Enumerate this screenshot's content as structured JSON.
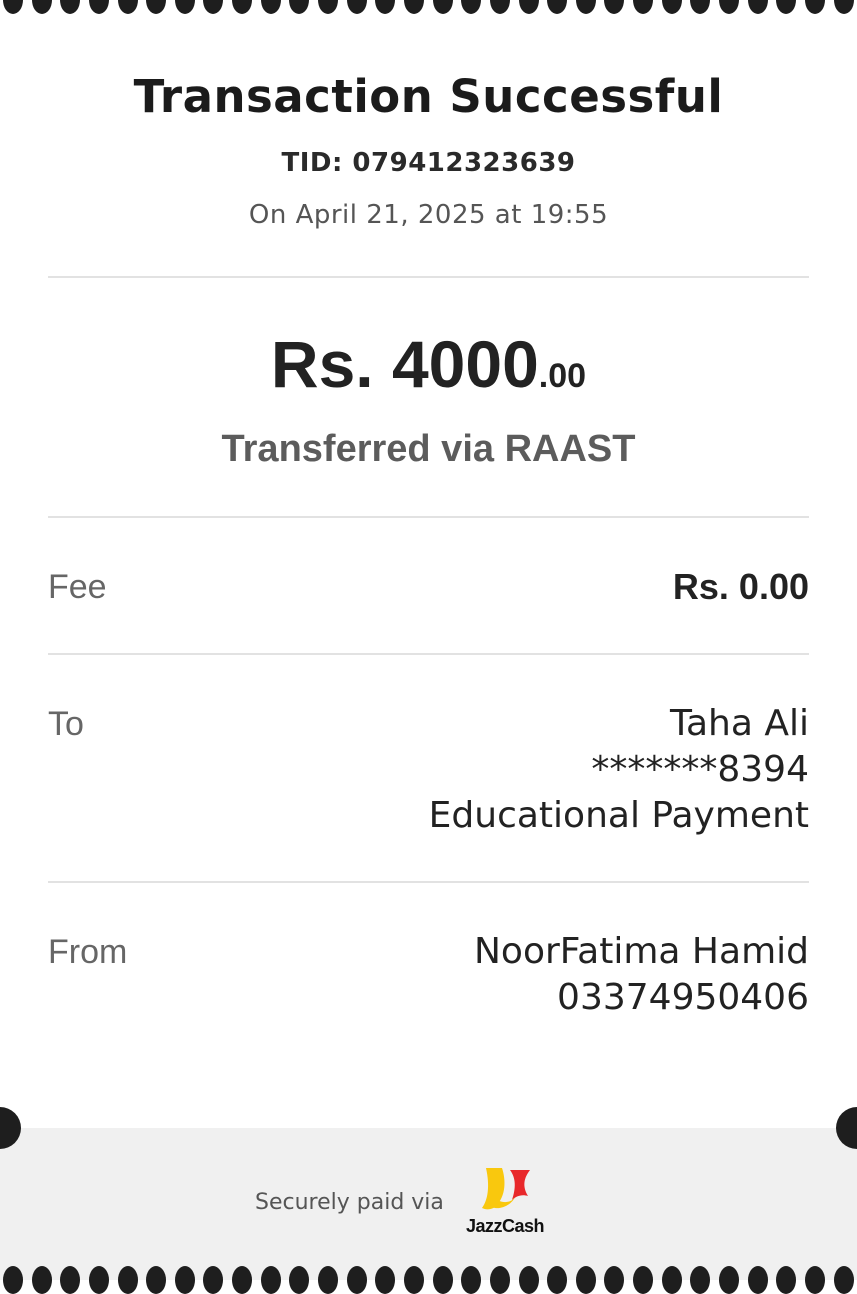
{
  "receipt": {
    "title": "Transaction Successful",
    "tid": "TID: 079412323639",
    "datetime": "On April 21, 2025 at 19:55",
    "amount_main": "Rs. 4000",
    "amount_cents": ".00",
    "transfer_method": "Transferred via RAAST",
    "fee": {
      "label": "Fee",
      "value": "Rs. 0.00"
    },
    "to": {
      "label": "To",
      "name": "Taha Ali",
      "account": "*******8394",
      "purpose": "Educational Payment"
    },
    "from": {
      "label": "From",
      "name": "NoorFatima Hamid",
      "number": "03374950406"
    }
  },
  "footer": {
    "secure_text": "Securely paid via",
    "logo_text": "JazzCash",
    "logo_colors": {
      "yellow": "#f9c80e",
      "red": "#e8282b"
    }
  }
}
